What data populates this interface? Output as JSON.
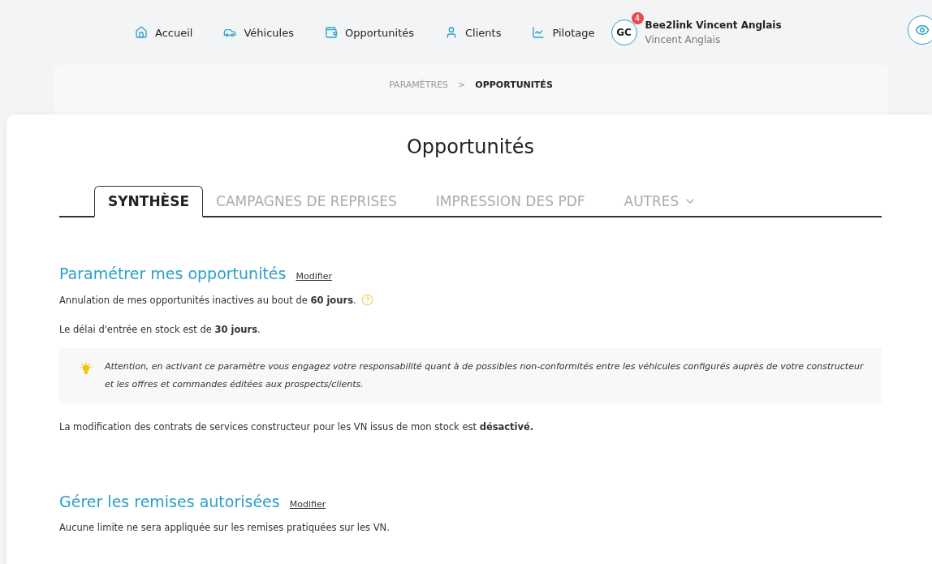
{
  "nav": {
    "items": [
      {
        "label": "Accueil"
      },
      {
        "label": "Véhicules"
      },
      {
        "label": "Opportunités"
      },
      {
        "label": "Clients"
      },
      {
        "label": "Pilotage"
      }
    ],
    "user": {
      "initials": "GC",
      "badge": "4",
      "name": "Bee2link Vincent Anglais",
      "subtitle": "Vincent Anglais"
    }
  },
  "breadcrumb": [
    "PARAMÈTRES",
    ">",
    "OPPORTUNITÉS"
  ],
  "page_title": "Opportunités",
  "tabs": [
    {
      "label": "SYNTHÈSE",
      "selected": true,
      "dropdown": false
    },
    {
      "label": "CAMPAGNES DE REPRISES",
      "selected": false,
      "dropdown": false
    },
    {
      "label": "IMPRESSION DES PDF",
      "selected": false,
      "dropdown": false
    },
    {
      "label": "AUTRES",
      "selected": false,
      "dropdown": true
    }
  ],
  "sections": [
    {
      "title": "Paramétrer mes opportunités",
      "link": "Modifier",
      "blocks": [
        {
          "kind": "text",
          "text": "Annulation de mes opportunités inactives au bout de **60 jours**.",
          "help": true
        },
        {
          "kind": "text",
          "text": "Le délai d'entrée en stock est de **30 jours**.",
          "help": false
        },
        {
          "kind": "notice",
          "text": "Attention, en activant ce paramètre vous engagez votre responsabilité quant à de possibles non-conformités entre les véhicules configurés auprès de votre constructeur et les offres et commandes éditées aux prospects/clients."
        },
        {
          "kind": "text",
          "text": "La modification des contrats de services constructeur pour les VN issus de mon stock est **désactivé.**",
          "help": false
        }
      ]
    },
    {
      "title": "Gérer les remises autorisées",
      "link": "Modifier",
      "blocks": [
        {
          "kind": "text",
          "text": "Aucune limite ne sera appliquée sur les remises pratiquées sur les VN.",
          "help": false
        }
      ]
    }
  ]
}
